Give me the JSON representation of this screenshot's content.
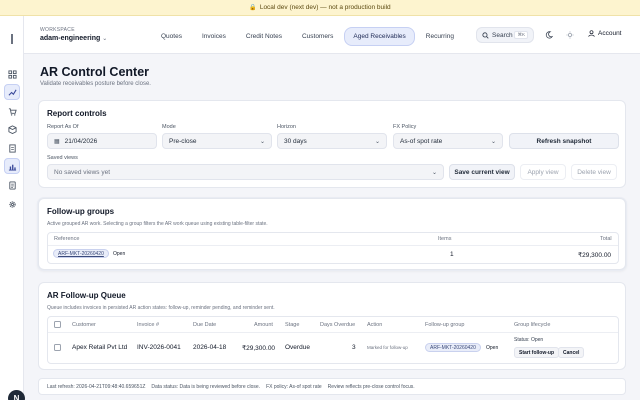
{
  "dev_banner": {
    "text": "Local dev (next dev) — not a production build",
    "icon": "lock-icon"
  },
  "workspace": {
    "label": "WORKSPACE",
    "name": "adam-engineering"
  },
  "nav": {
    "tabs": [
      {
        "label": "Quotes",
        "active": false
      },
      {
        "label": "Invoices",
        "active": false
      },
      {
        "label": "Credit Notes",
        "active": false
      },
      {
        "label": "Customers",
        "active": false
      },
      {
        "label": "Aged Receivables",
        "active": true
      },
      {
        "label": "Recurring",
        "active": false
      }
    ]
  },
  "topbar": {
    "search_label": "Search",
    "search_shortcut": "⌘K",
    "account_label": "Account"
  },
  "sidebar": {
    "icons": [
      "grid-icon",
      "trend-icon",
      "cart-icon",
      "box-icon",
      "document-icon",
      "chart-icon",
      "receipt-icon",
      "gear-icon"
    ],
    "active_index": [
      1,
      5
    ],
    "avatar_initial": "N"
  },
  "page": {
    "title": "AR Control Center",
    "subtitle": "Validate receivables posture before close."
  },
  "report_controls": {
    "title": "Report controls",
    "as_of_label": "Report As Of",
    "as_of_value": "21/04/2026",
    "mode_label": "Mode",
    "mode_value": "Pre-close",
    "horizon_label": "Horizon",
    "horizon_value": "30 days",
    "fx_label": "FX Policy",
    "fx_value": "As-of spot rate",
    "refresh_label": "Refresh snapshot",
    "saved_views_label": "Saved views",
    "saved_views_value": "No saved views yet",
    "save_view_label": "Save current view",
    "apply_view_label": "Apply view",
    "delete_view_label": "Delete view"
  },
  "followup_groups": {
    "title": "Follow-up groups",
    "description": "Active grouped AR work. Selecting a group filters the AR work queue using existing table-filter state.",
    "headers": {
      "reference": "Reference",
      "items": "Items",
      "total": "Total"
    },
    "rows": [
      {
        "reference": "ARF-MKT-20260420",
        "status": "Open",
        "items": "1",
        "total": "₹29,300.00"
      }
    ]
  },
  "followup_queue": {
    "title": "AR Follow-up Queue",
    "description": "Queue includes invoices in persisted AR action states: follow-up, reminder pending, and reminder sent.",
    "headers": {
      "customer": "Customer",
      "invoice": "Invoice #",
      "due_date": "Due Date",
      "amount": "Amount",
      "stage": "Stage",
      "days_overdue": "Days Overdue",
      "action": "Action",
      "group": "Follow-up group",
      "lifecycle": "Group lifecycle"
    },
    "rows": [
      {
        "customer": "Apex Retail Pvt Ltd",
        "invoice": "INV-2026-0041",
        "due_date": "2026-04-18",
        "amount": "₹29,300.00",
        "stage": "Overdue",
        "days_overdue": "3",
        "action": "Marked for follow-up",
        "group": "ARF-MKT-20260420",
        "group_status": "Open",
        "lifecycle_status": "Status: Open",
        "start_label": "Start follow-up",
        "cancel_label": "Cancel"
      }
    ]
  },
  "footer": {
    "last_refresh": "Last refresh: 2026-04-21T09:48:40.659651Z",
    "data_status": "Data status: Data is being reviewed before close.",
    "fx_policy": "FX policy: As-of spot rate",
    "review": "Review reflects pre-close control focus."
  }
}
